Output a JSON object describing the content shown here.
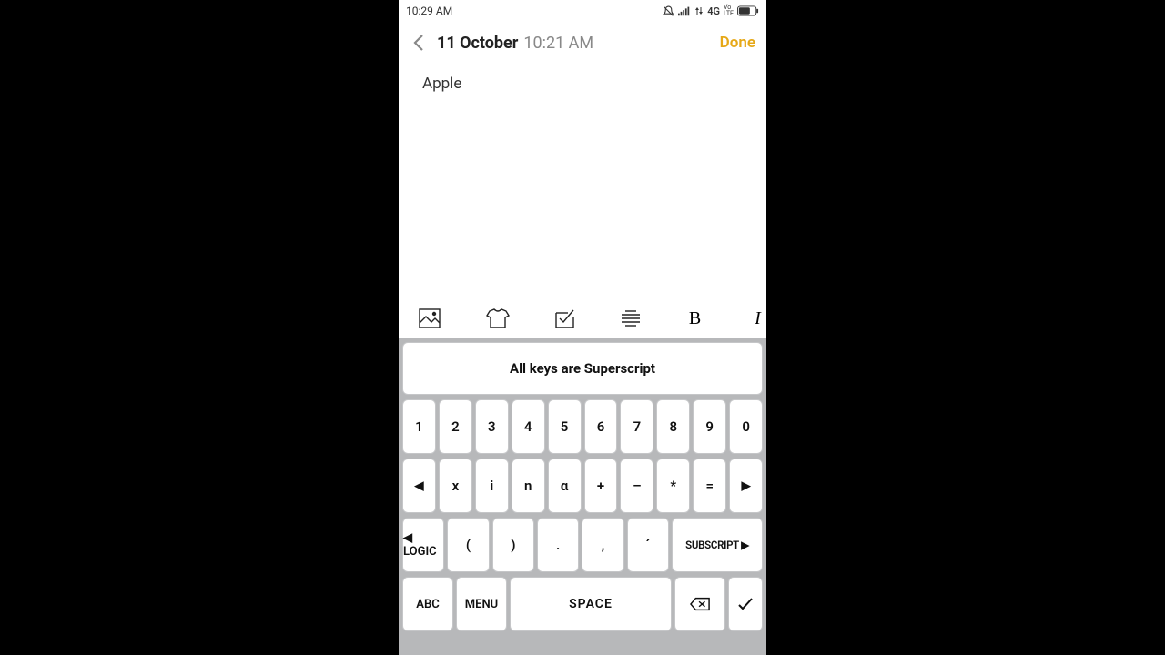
{
  "status": {
    "time": "10:29 AM",
    "network": "4G",
    "volte": "VoLTE"
  },
  "nav": {
    "date": "11 October",
    "time": "10:21 AM",
    "done": "Done"
  },
  "note": {
    "text": "Apple"
  },
  "toolbar_icons": [
    "image-icon",
    "tshirt-icon",
    "checklist-icon",
    "align-icon",
    "bold-icon",
    "italic-icon"
  ],
  "keyboard": {
    "hint": "All keys are Superscript",
    "row1": [
      "1",
      "2",
      "3",
      "4",
      "5",
      "6",
      "7",
      "8",
      "9",
      "0"
    ],
    "row2": [
      "◀",
      "x",
      "i",
      "n",
      "α",
      "+",
      "–",
      "*",
      "=",
      "▶"
    ],
    "row3": {
      "logic": "◀ LOGIC",
      "keys": [
        "(",
        ")",
        ".",
        ",",
        "´"
      ],
      "subscript": "SUBSCRIPT ▶"
    },
    "row4": {
      "abc": "ABC",
      "menu": "MENU",
      "space": "SPACE",
      "enter": "✓"
    }
  }
}
